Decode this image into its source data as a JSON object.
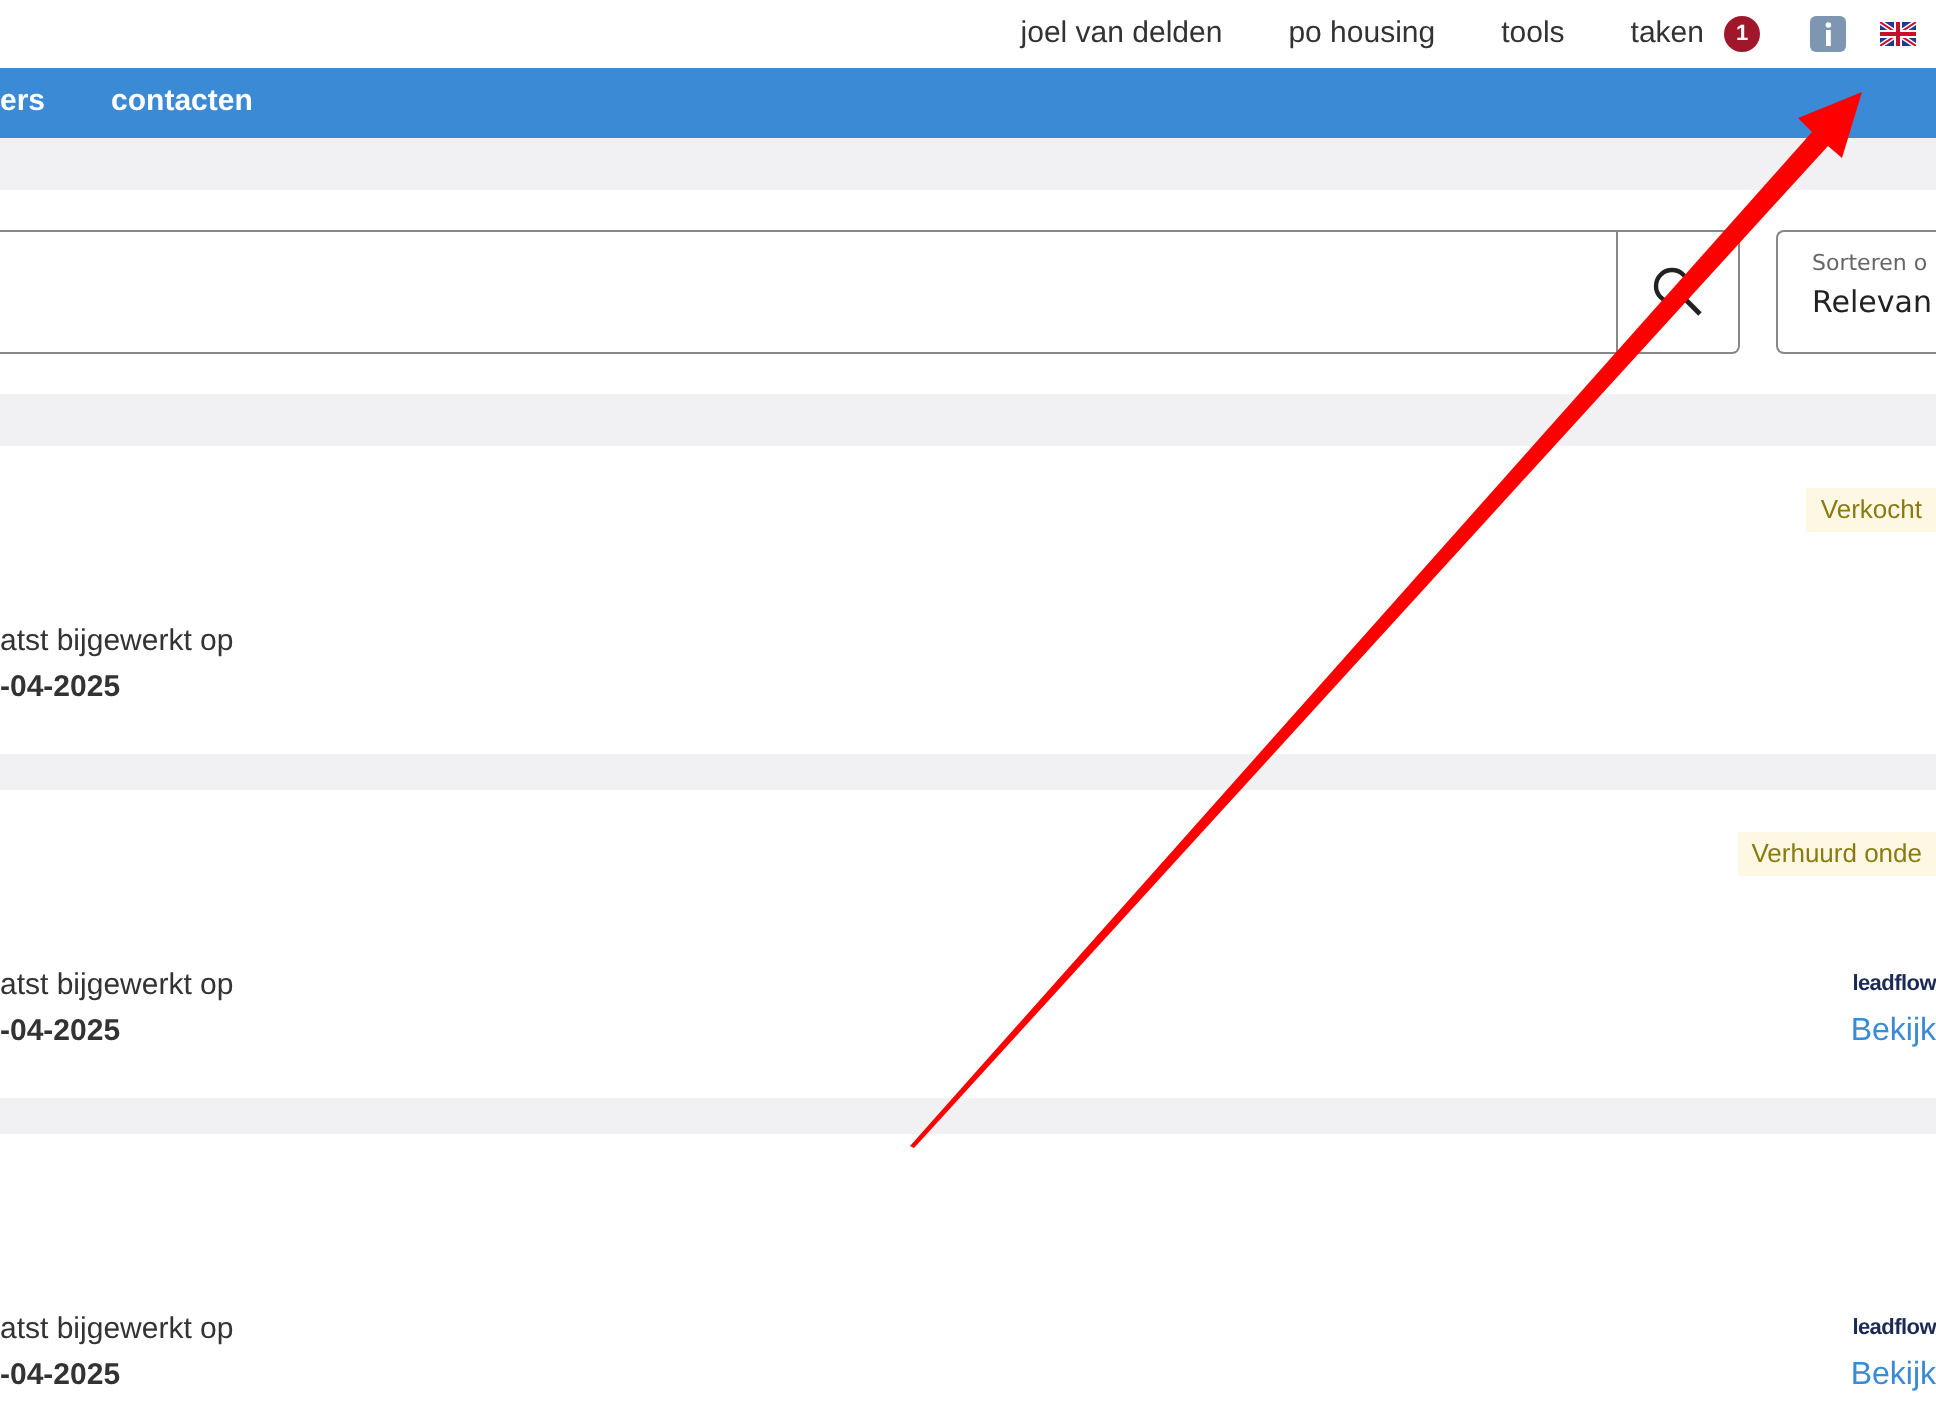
{
  "top_nav": {
    "items": [
      "joel van delden",
      "po housing",
      "tools"
    ],
    "tasks": {
      "label": "taken",
      "count": "1"
    }
  },
  "main_nav": {
    "items": [
      "ers",
      "contacten"
    ]
  },
  "search": {
    "sort_label": "Sorteren o",
    "sort_value": "Relevan"
  },
  "results": [
    {
      "status": "Verkocht",
      "updated_label": "atst bijgewerkt op",
      "updated_date": "-04-2025"
    },
    {
      "status": "Verhuurd onde",
      "updated_label": "atst bijgewerkt op",
      "updated_date": "-04-2025",
      "source": "leadflow",
      "link": "Bekijk"
    },
    {
      "updated_label": "atst bijgewerkt op",
      "updated_date": "-04-2025",
      "source": "leadflow",
      "link": "Bekijk"
    }
  ]
}
